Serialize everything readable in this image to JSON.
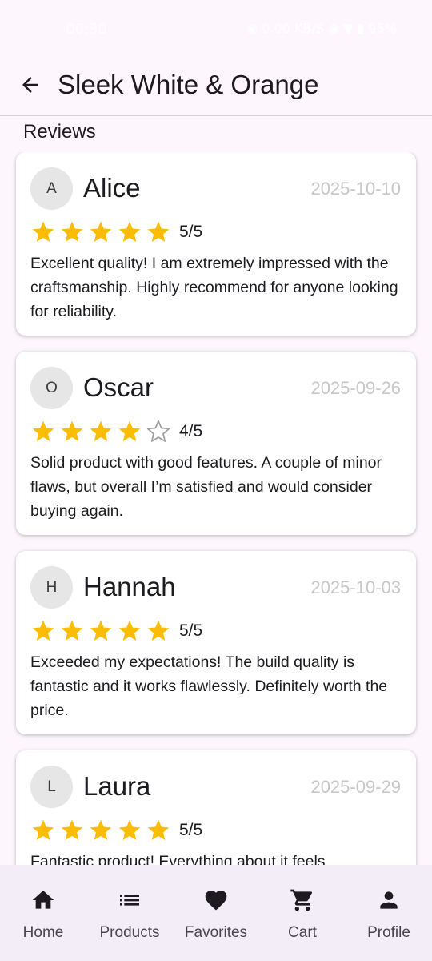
{
  "status_bar": {
    "time": "00:30",
    "right_text": "◉ 0.00 KB/S  ◉  ▼  ▮ 95%"
  },
  "app_bar": {
    "title": "Sleek White & Orange"
  },
  "section": {
    "title": "Reviews"
  },
  "colors": {
    "star_filled": "#fbbc04",
    "star_empty": "#9e9e9e",
    "date": "#c8c8c8",
    "nav_bg": "#f3edf7",
    "page_bg": "#fdf7fd"
  },
  "reviews": [
    {
      "initial": "A",
      "name": "Alice",
      "date": "2025-10-10",
      "rating": 5,
      "rating_text": "5/5",
      "text": "Excellent quality! I am extremely impressed with the craftsmanship. Highly recommend for anyone looking for reliability."
    },
    {
      "initial": "O",
      "name": "Oscar",
      "date": "2025-09-26",
      "rating": 4,
      "rating_text": "4/5",
      "text": "Solid product with good features. A couple of minor flaws, but overall I’m satisfied and would consider buying again."
    },
    {
      "initial": "H",
      "name": "Hannah",
      "date": "2025-10-03",
      "rating": 5,
      "rating_text": "5/5",
      "text": "Exceeded my expectations! The build quality is fantastic and it works flawlessly. Definitely worth the price."
    },
    {
      "initial": "L",
      "name": "Laura",
      "date": "2025-09-29",
      "rating": 5,
      "rating_text": "5/5",
      "text": "Fantastic product! Everything about it feels"
    }
  ],
  "nav": [
    {
      "label": "Home",
      "icon": "home-icon"
    },
    {
      "label": "Products",
      "icon": "list-icon"
    },
    {
      "label": "Favorites",
      "icon": "heart-icon"
    },
    {
      "label": "Cart",
      "icon": "cart-icon"
    },
    {
      "label": "Profile",
      "icon": "person-icon"
    }
  ]
}
